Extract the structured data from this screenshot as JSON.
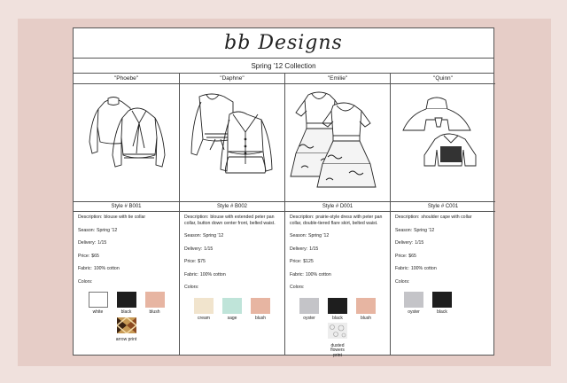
{
  "header": {
    "brand": "bb Designs",
    "collection": "Spring '12 Collection"
  },
  "labels": {
    "description": "Description:",
    "season": "Season:",
    "delivery": "Delivery:",
    "price": "Price:",
    "fabric": "Fabric:",
    "colors": "Colors:"
  },
  "styles": [
    {
      "name": "\"Phoebe\"",
      "style_no": "Style # B001",
      "description": "blouse with tie collar",
      "season": "Spring '12",
      "delivery": "1/15",
      "price": "$65",
      "fabric": "100% cotton",
      "colors": [
        {
          "name": "white",
          "hex": "#ffffff"
        },
        {
          "name": "black",
          "hex": "#1e1e1e"
        },
        {
          "name": "blush",
          "hex": "#e7b5a2"
        },
        {
          "name": "arrow print",
          "hex": "#7a4a2a"
        }
      ]
    },
    {
      "name": "\"Daphne\"",
      "style_no": "Style # B002",
      "description": "blouse with extended peter pan collar, button down center front, belted waist.",
      "season": "Spring '12",
      "delivery": "1/15",
      "price": "$75",
      "fabric": "100% cotton",
      "colors": [
        {
          "name": "cream",
          "hex": "#f1e4cd"
        },
        {
          "name": "sage",
          "hex": "#bfe4d9"
        },
        {
          "name": "blush",
          "hex": "#e7b5a2"
        }
      ]
    },
    {
      "name": "\"Emilie\"",
      "style_no": "Style # D001",
      "description": "prairie-style dress with peter pan collar, double-tiered flare skirt, belted waist.",
      "season": "Spring '12",
      "delivery": "1/15",
      "price": "$125",
      "fabric": "100% cotton",
      "colors": [
        {
          "name": "oyster",
          "hex": "#c4c4c8"
        },
        {
          "name": "black",
          "hex": "#1e1e1e"
        },
        {
          "name": "blush",
          "hex": "#e7b5a2"
        },
        {
          "name": "dusted flowers print",
          "hex": "#e6e6e6"
        }
      ]
    },
    {
      "name": "\"Quinn\"",
      "style_no": "Style # C001",
      "description": "shoulder cape with collar",
      "season": "Spring '12",
      "delivery": "1/15",
      "price": "$65",
      "fabric": "100% cotton",
      "colors": [
        {
          "name": "oyster",
          "hex": "#c4c4c8"
        },
        {
          "name": "black",
          "hex": "#1e1e1e"
        }
      ]
    }
  ]
}
